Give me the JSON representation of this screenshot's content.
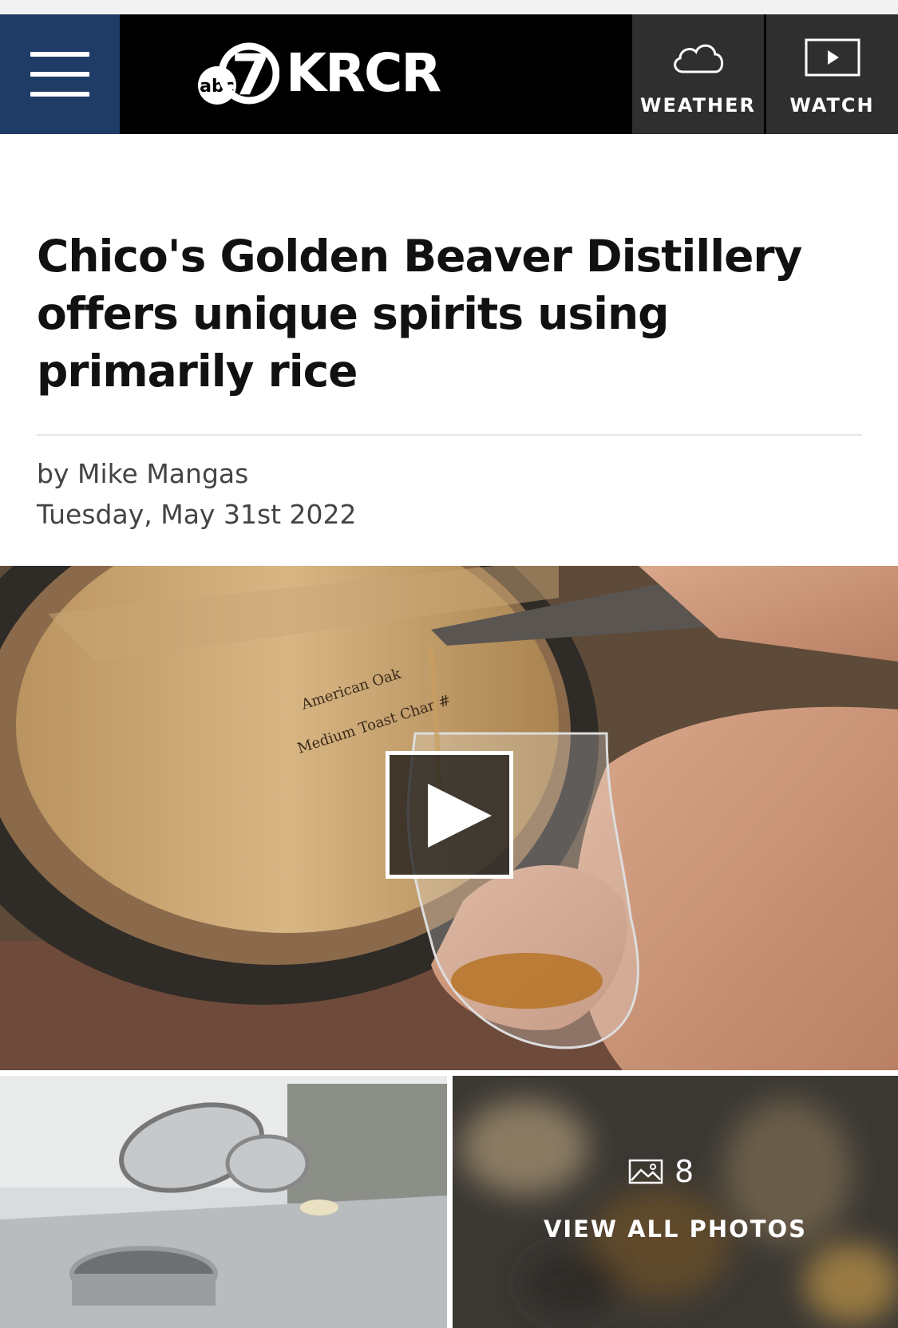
{
  "header": {
    "brand_abc": "abc",
    "brand_seven": "7",
    "brand_name": "KRCR",
    "weather_label": "WEATHER",
    "watch_label": "WATCH",
    "accent_color": "#1f3c66"
  },
  "article": {
    "headline": "Chico's Golden Beaver Distillery offers unique spirits using primarily rice",
    "byline": "by Mike Mangas",
    "date": "Tuesday, May 31st 2022"
  },
  "media": {
    "hero_play_icon": "play-icon",
    "barrel_text_1": "American Oak",
    "barrel_text_2": "Medium Toast Char #",
    "photo_count": "8",
    "view_all_label": "VIEW ALL PHOTOS",
    "gallery_icon": "image-icon"
  }
}
